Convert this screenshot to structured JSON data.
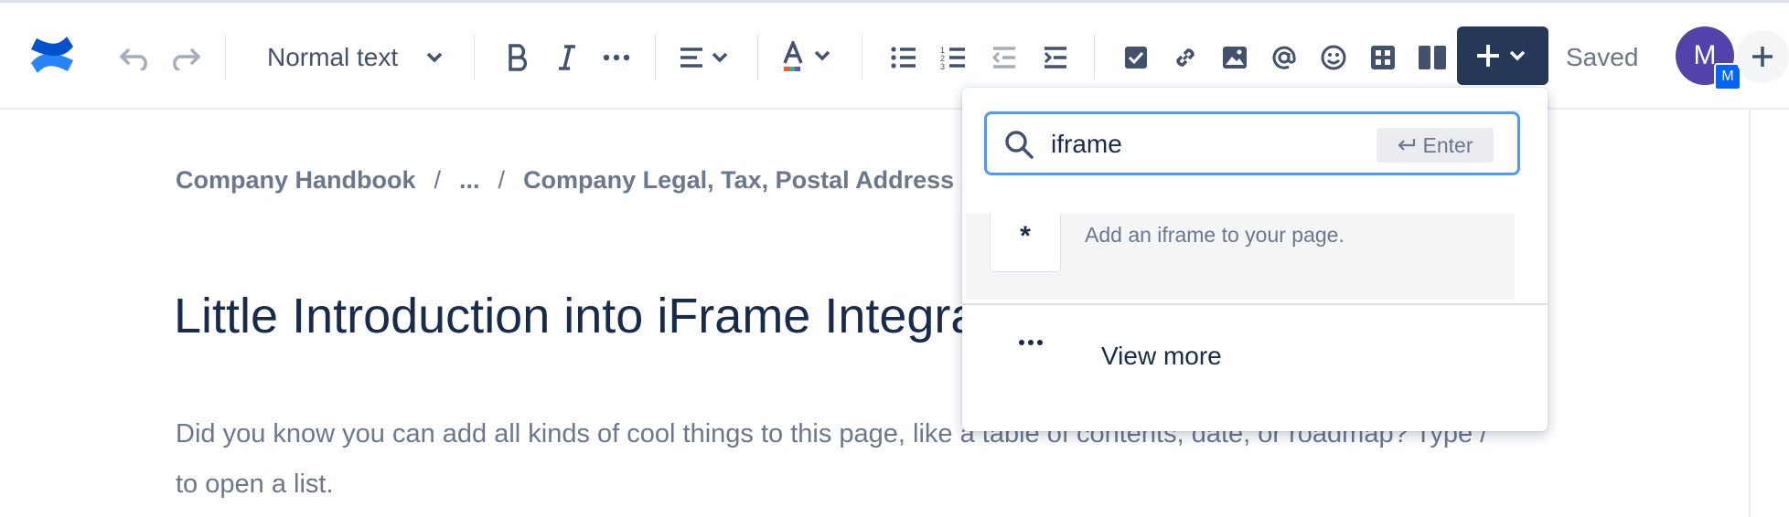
{
  "toolbar": {
    "text_style": "Normal text",
    "saved_label": "Saved",
    "avatar_initial": "M",
    "avatar_badge": "M"
  },
  "breadcrumb": {
    "items": [
      "Company Handbook",
      "...",
      "Company Legal, Tax, Postal Address"
    ],
    "separator": "/"
  },
  "page": {
    "title": "Little Introduction into iFrame Integration",
    "body": "Did you know you can add all kinds of cool things to this page, like a table of contents, date, or roadmap? Type / to open a list."
  },
  "insert_menu": {
    "search_value": "iframe",
    "enter_hint": "Enter",
    "result": {
      "icon": "*",
      "description": "Add an iframe to your page."
    },
    "view_more_label": "View more"
  },
  "colors": {
    "accent": "#253858",
    "focus": "#4c9aff",
    "brand": "#2684ff",
    "avatar": "#5243aa"
  }
}
